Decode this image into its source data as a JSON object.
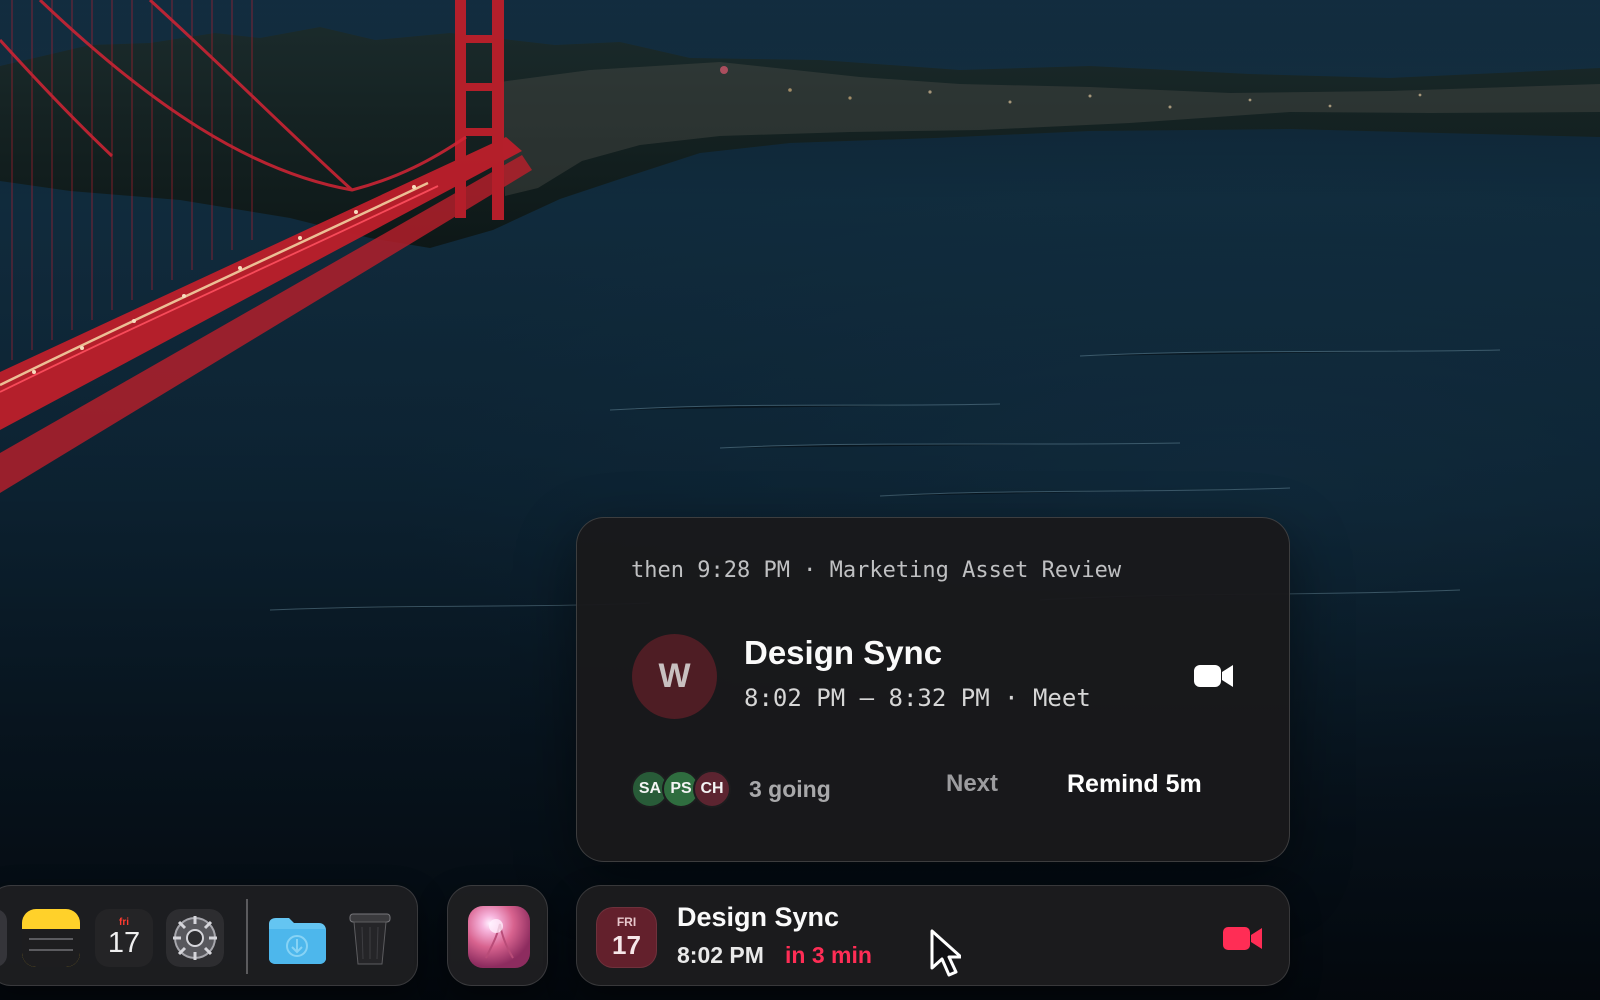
{
  "desktop": {
    "wallpaper": "night bridge and bay wallpaper"
  },
  "dock": {
    "apps": [
      {
        "name": "notes",
        "icon": "notes-icon"
      },
      {
        "name": "calendar",
        "icon": "calendar-icon",
        "day": "fri",
        "date": "17"
      },
      {
        "name": "system-settings",
        "icon": "gear-icon"
      },
      {
        "name": "downloads",
        "icon": "folder-download-icon"
      },
      {
        "name": "trash",
        "icon": "trash-icon"
      }
    ],
    "floating_app": {
      "name": "app",
      "icon": "pink-sphere-app-icon"
    }
  },
  "event_panel": {
    "then_text": "then 9:28 PM · Marketing Asset Review",
    "host_initial": "W",
    "title": "Design Sync",
    "time_text": "8:02 PM – 8:32 PM · Meet",
    "attendees": [
      {
        "initials": "SA",
        "color": "#2a5a38"
      },
      {
        "initials": "PS",
        "color": "#2f6b3f"
      },
      {
        "initials": "CH",
        "color": "#5a2430"
      }
    ],
    "going_text": "3 going",
    "next_label": "Next",
    "remind_label": "Remind 5m",
    "video_icon": "video-camera-icon"
  },
  "mini_bar": {
    "calendar_day": "FRI",
    "calendar_date": "17",
    "title": "Design Sync",
    "time": "8:02 PM",
    "countdown": "in 3 min",
    "video_icon": "video-camera-icon",
    "countdown_color": "#ff2d55",
    "video_color": "#ff2d55"
  },
  "pointer": {
    "icon": "mouse-pointer-icon"
  }
}
